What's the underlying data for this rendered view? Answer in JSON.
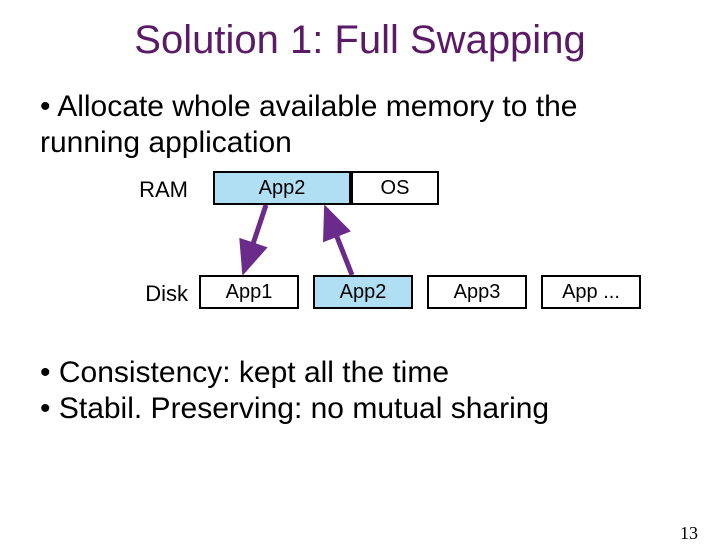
{
  "title": "Solution 1: Full Swapping",
  "bullets": {
    "intro": "Allocate whole available memory to the running application",
    "consistency": "Consistency: kept all the time",
    "stability": "Stabil. Preserving: no mutual sharing"
  },
  "diagram": {
    "ram_label": "RAM",
    "disk_label": "Disk",
    "ram": {
      "app": "App2",
      "os": "OS"
    },
    "disk": [
      "App1",
      "App2",
      "App3",
      "App ..."
    ]
  },
  "page_number": "13"
}
